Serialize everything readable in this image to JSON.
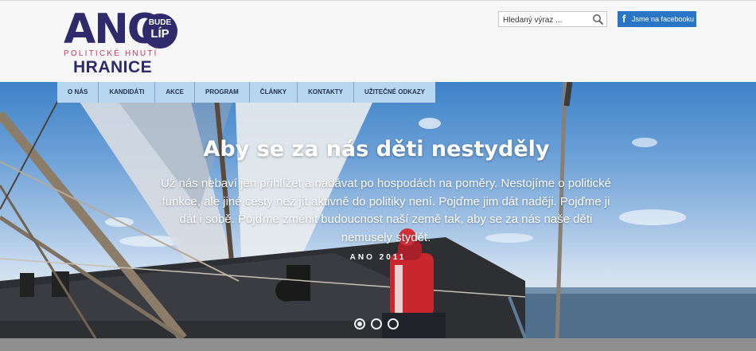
{
  "header": {
    "logo": {
      "main": "ANO",
      "badge_top": "BUDE",
      "badge_bottom": "LÍP",
      "subtitle": "POLITICKÉ HNUTÍ",
      "city": "HRANICE"
    },
    "search": {
      "placeholder": "Hledaný výraz ...",
      "icon": "search-icon"
    },
    "facebook": {
      "label": "Jsme na facebooku",
      "icon": "facebook-icon",
      "color": "#2a76c6"
    }
  },
  "nav": {
    "items": [
      "O NÁS",
      "KANDIDÁTI",
      "AKCE",
      "PROGRAM",
      "ČLÁNKY",
      "KONTAKTY",
      "UŽITEČNÉ ODKAZY"
    ]
  },
  "slider": {
    "title": "Aby se za nás děti nestyděly",
    "text": "Už nás nebaví jen přihlížet a nadávat po hospodách na poměry. Nestojíme o politické funkce, ale jiné cesty než jít aktivně do politiky není. Pojďme jim dát naději. Pojďme ji dát i sobě. Pojďme změnit budoucnost naší země tak, aby se za nás naše děti nemusely stydět.",
    "author": "ANO 2011",
    "dots": {
      "count": 3,
      "active_index": 1
    }
  },
  "colors": {
    "brand": "#2e2a6b",
    "accent": "#c8365f",
    "nav": "#b7d6f0"
  }
}
